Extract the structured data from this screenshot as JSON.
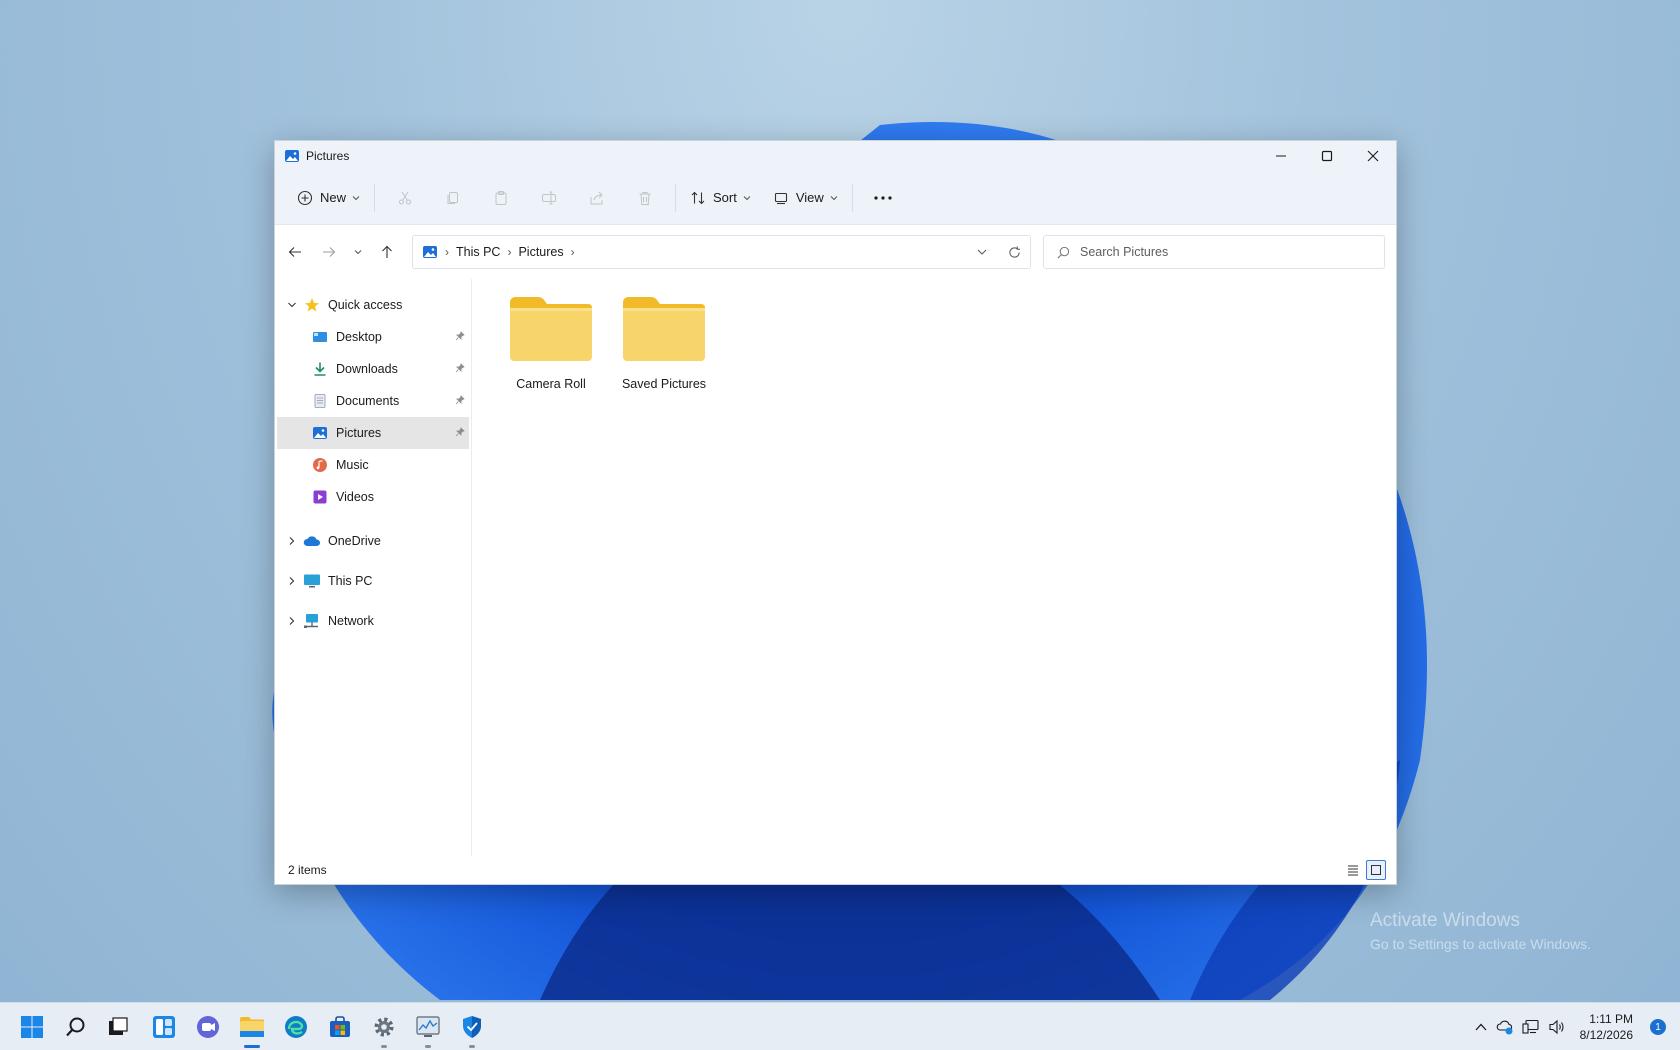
{
  "window": {
    "title": "Pictures",
    "minimize_icon": "minimize-icon",
    "maximize_icon": "maximize-icon",
    "close_icon": "close-icon"
  },
  "commandbar": {
    "new_label": "New",
    "sort_label": "Sort",
    "view_label": "View",
    "disabled_actions": [
      "cut",
      "copy",
      "paste",
      "rename",
      "share",
      "delete"
    ]
  },
  "address": {
    "breadcrumbs": [
      "This PC",
      "Pictures"
    ],
    "search_placeholder": "Search Pictures"
  },
  "navpane": {
    "quick_access": "Quick access",
    "pinned": [
      {
        "label": "Desktop",
        "pinned": true
      },
      {
        "label": "Downloads",
        "pinned": true
      },
      {
        "label": "Documents",
        "pinned": true
      },
      {
        "label": "Pictures",
        "pinned": true,
        "selected": true
      },
      {
        "label": "Music",
        "pinned": false
      },
      {
        "label": "Videos",
        "pinned": false
      }
    ],
    "roots": [
      "OneDrive",
      "This PC",
      "Network"
    ]
  },
  "content": {
    "items": [
      {
        "name": "Camera Roll",
        "type": "folder"
      },
      {
        "name": "Saved Pictures",
        "type": "folder"
      }
    ]
  },
  "status": {
    "item_count": "2 items"
  },
  "watermark": {
    "line1": "Activate Windows",
    "line2": "Go to Settings to activate Windows."
  },
  "taskbar": {
    "apps": [
      "start",
      "search",
      "task-view",
      "widgets",
      "chat",
      "file-explorer",
      "edge",
      "store",
      "settings",
      "resource-monitor",
      "defender"
    ],
    "active_app": "file-explorer",
    "time": "1:11 PM",
    "date": "8/12/2026",
    "notification_count": "1"
  },
  "colors": {
    "accent": "#1a6fd1",
    "folder_yellow": "#f8d56a",
    "folder_tab": "#f2b929"
  }
}
